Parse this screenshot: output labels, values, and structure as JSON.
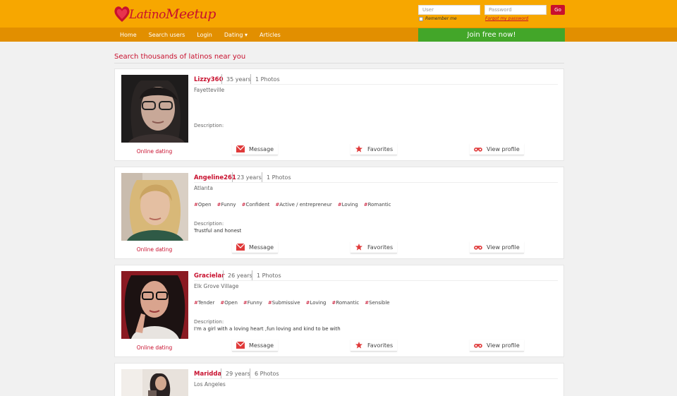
{
  "header": {
    "logo_text_a": "Latino",
    "logo_text_b": "Meetup",
    "user_placeholder": "User",
    "password_placeholder": "Password",
    "go_label": "Go",
    "remember_label": "Remember me",
    "forgot_label": "Forgot my password"
  },
  "nav": {
    "items": [
      "Home",
      "Search users",
      "Login",
      "Dating ▾",
      "Articles"
    ],
    "join_label": "Join free now!"
  },
  "main": {
    "heading": "Search thousands of latinos near you"
  },
  "colors": {
    "brand_orange": "#f7a700",
    "nav_orange": "#e28f00",
    "accent_red": "#c8102e",
    "join_green": "#43a629"
  },
  "actions": {
    "message": "Message",
    "favorites": "Favorites",
    "view_profile": "View profile",
    "online_label": "Online dating",
    "description_label": "Description:"
  },
  "profiles": [
    {
      "name": "Lizzy360",
      "age": "35 years",
      "photos": "1 Photos",
      "city": "Fayetteville",
      "tags": [],
      "description": ""
    },
    {
      "name": "Angeline261",
      "age": "23 years",
      "photos": "1 Photos",
      "city": "Atlanta",
      "tags": [
        "Open",
        "Funny",
        "Confident",
        "Active / entrepreneur",
        "Loving",
        "Romantic"
      ],
      "description": "Trustful and honest"
    },
    {
      "name": "Gracielar",
      "age": "26 years",
      "photos": "1 Photos",
      "city": "Elk Grove Village",
      "tags": [
        "Tender",
        "Open",
        "Funny",
        "Submissive",
        "Loving",
        "Romantic",
        "Sensible"
      ],
      "description": "I'm a girl with a loving heart ,fun loving and kind to be with"
    },
    {
      "name": "Maridda",
      "age": "29 years",
      "photos": "6 Photos",
      "city": "Los Angeles",
      "tags": [],
      "description": ""
    }
  ]
}
